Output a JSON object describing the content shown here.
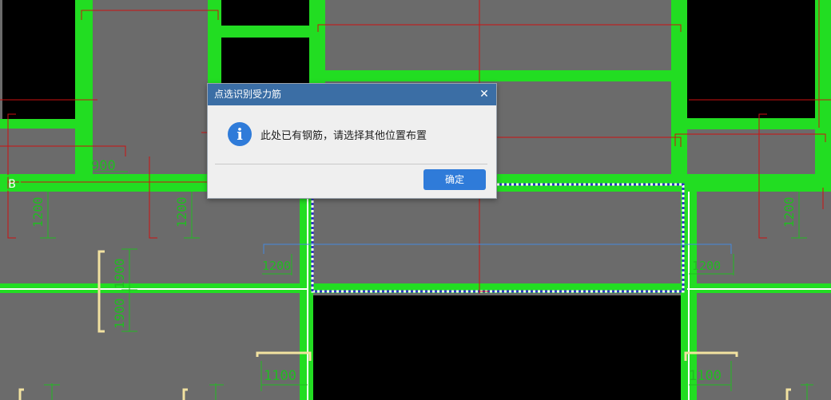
{
  "dialog": {
    "title": "点选识别受力筋",
    "close_glyph": "✕",
    "icon": "info-icon",
    "icon_glyph": "i",
    "message": "此处已有钢筋，请选择其他位置布置",
    "ok_label": "确定"
  },
  "drawing": {
    "axis_label": "B",
    "dimensions": [
      "900",
      "1200",
      "1200",
      "1200",
      "1200",
      "1900",
      "1900",
      "1200",
      "1200",
      "1100",
      "1100"
    ],
    "colors": {
      "background": "#6b6b6b",
      "opening": "#000000",
      "beam": "#22dd22",
      "rebar": "#cc1111",
      "dimension": "#22bb22",
      "selection": "#3333cc",
      "distribution": "#4488dd",
      "support": "#f2e2a0"
    }
  }
}
